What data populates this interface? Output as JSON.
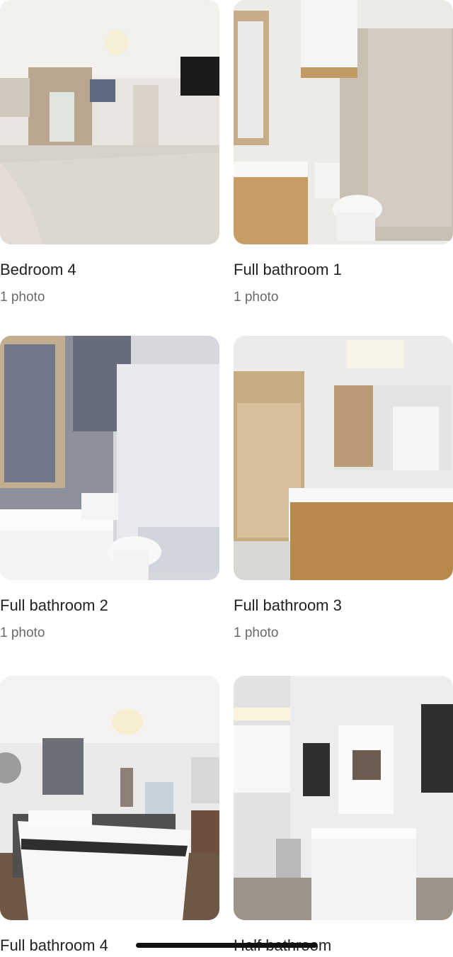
{
  "rooms": [
    {
      "name": "Bedroom 4",
      "count": "1 photo"
    },
    {
      "name": "Full bathroom 1",
      "count": "1 photo"
    },
    {
      "name": "Full bathroom 2",
      "count": "1 photo"
    },
    {
      "name": "Full bathroom 3",
      "count": "1 photo"
    },
    {
      "name": "Full bathroom 4",
      "count": ""
    },
    {
      "name": "Half bathroom",
      "count": ""
    }
  ],
  "colors": {
    "text": "#222222",
    "subtext": "#6a6a6a",
    "background": "#ffffff"
  }
}
